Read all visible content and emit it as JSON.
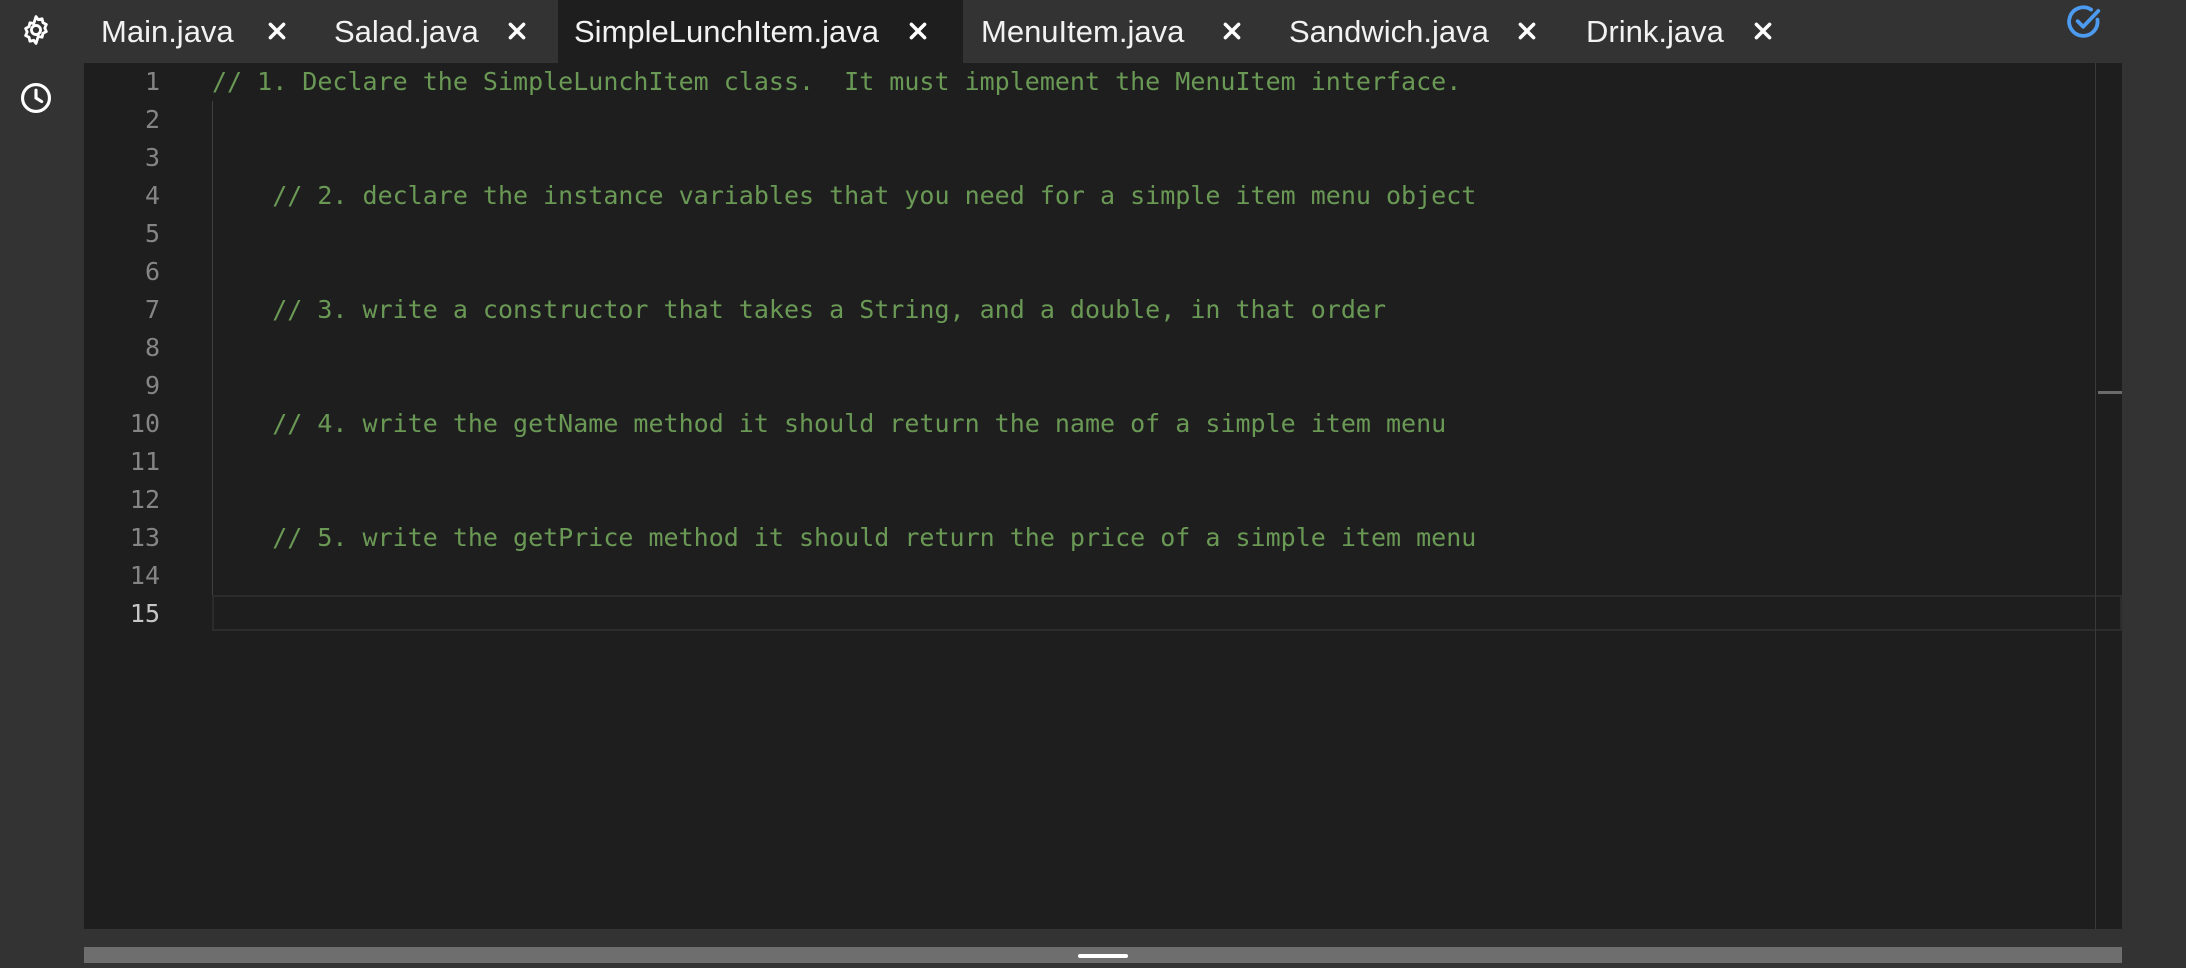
{
  "rail": {
    "icons": [
      "settings-icon",
      "history-icon"
    ]
  },
  "tabs": [
    {
      "label": "Main.java",
      "active": false
    },
    {
      "label": "Salad.java",
      "active": false
    },
    {
      "label": "SimpleLunchItem.java",
      "active": true
    },
    {
      "label": "MenuItem.java",
      "active": false
    },
    {
      "label": "Sandwich.java",
      "active": false
    },
    {
      "label": "Drink.java",
      "active": false
    }
  ],
  "status_icon": "check-circle-icon",
  "editor": {
    "current_line": 15,
    "lines": [
      {
        "num": "1",
        "text": "// 1. Declare the SimpleLunchItem class.  It must implement the MenuItem interface."
      },
      {
        "num": "2",
        "text": ""
      },
      {
        "num": "3",
        "text": ""
      },
      {
        "num": "4",
        "text": "    // 2. declare the instance variables that you need for a simple item menu object"
      },
      {
        "num": "5",
        "text": ""
      },
      {
        "num": "6",
        "text": ""
      },
      {
        "num": "7",
        "text": "    // 3. write a constructor that takes a String, and a double, in that order"
      },
      {
        "num": "8",
        "text": ""
      },
      {
        "num": "9",
        "text": ""
      },
      {
        "num": "10",
        "text": "    // 4. write the getName method it should return the name of a simple item menu"
      },
      {
        "num": "11",
        "text": ""
      },
      {
        "num": "12",
        "text": ""
      },
      {
        "num": "13",
        "text": "    // 5. write the getPrice method it should return the price of a simple item menu"
      },
      {
        "num": "14",
        "text": ""
      },
      {
        "num": "15",
        "text": ""
      }
    ]
  },
  "colors": {
    "comment": "#6a9955",
    "accent": "#4d9bf0",
    "editor_bg": "#1e1e1e",
    "chrome_bg": "#333333"
  }
}
